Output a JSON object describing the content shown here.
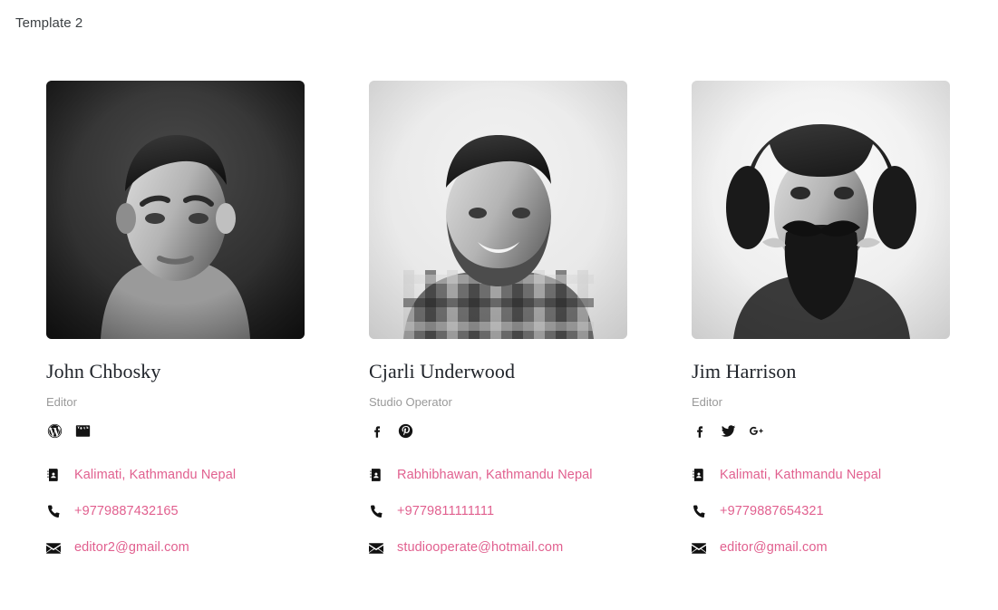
{
  "page": {
    "title": "Template 2",
    "accent_color": "#e1608f",
    "name_color": "#21252b",
    "role_color": "#9a9a9a",
    "icon_color": "#111111",
    "background": "#ffffff"
  },
  "members": [
    {
      "name": "John Chbosky",
      "role": "Editor",
      "photo_alt": "black-and-white portrait of a young man against a dark backdrop",
      "socials": [
        {
          "icon": "wordpress-icon",
          "label": "WordPress"
        },
        {
          "icon": "youtube-icon",
          "label": "YouTube"
        }
      ],
      "contacts": [
        {
          "icon": "address-book-icon",
          "label": "Address",
          "value": "Kalimati, Kathmandu Nepal"
        },
        {
          "icon": "phone-icon",
          "label": "Phone",
          "value": "+9779887432165"
        },
        {
          "icon": "envelope-icon",
          "label": "Email",
          "value": "editor2@gmail.com"
        }
      ]
    },
    {
      "name": "Cjarli Underwood",
      "role": "Studio Operator",
      "photo_alt": "black-and-white portrait of a bearded man in a plaid shirt on a light backdrop",
      "socials": [
        {
          "icon": "facebook-icon",
          "label": "Facebook"
        },
        {
          "icon": "pinterest-icon",
          "label": "Pinterest"
        }
      ],
      "contacts": [
        {
          "icon": "address-book-icon",
          "label": "Address",
          "value": "Rabhibhawan, Kathmandu Nepal"
        },
        {
          "icon": "phone-icon",
          "label": "Phone",
          "value": "+9779811111111"
        },
        {
          "icon": "envelope-icon",
          "label": "Email",
          "value": "studiooperate@hotmail.com"
        }
      ]
    },
    {
      "name": "Jim Harrison",
      "role": "Editor",
      "photo_alt": "black-and-white portrait of a long-haired man twirling his moustache",
      "socials": [
        {
          "icon": "facebook-icon",
          "label": "Facebook"
        },
        {
          "icon": "twitter-icon",
          "label": "Twitter"
        },
        {
          "icon": "google-plus-icon",
          "label": "Google Plus"
        }
      ],
      "contacts": [
        {
          "icon": "address-book-icon",
          "label": "Address",
          "value": "Kalimati, Kathmandu Nepal"
        },
        {
          "icon": "phone-icon",
          "label": "Phone",
          "value": "+9779887654321"
        },
        {
          "icon": "envelope-icon",
          "label": "Email",
          "value": "editor@gmail.com"
        }
      ]
    }
  ]
}
